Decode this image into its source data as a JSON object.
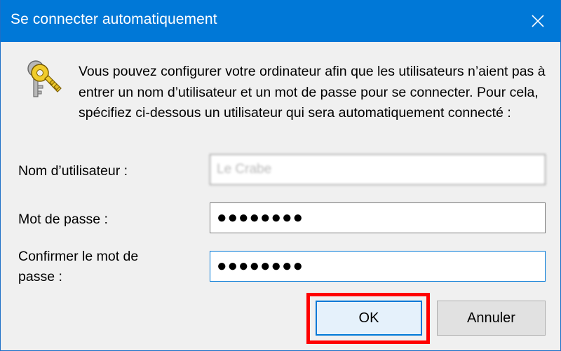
{
  "window": {
    "title": "Se connecter automatiquement"
  },
  "icons": {
    "close": "close-icon",
    "keys": "keys-icon"
  },
  "message": "Vous pouvez configurer votre ordinateur afin que les utilisateurs n’aient pas à entrer un nom d’utilisateur et un mot de passe pour se connecter. Pour cela, spécifiez ci-dessous un utilisateur qui sera automatiquement connecté :",
  "form": {
    "username_label": "Nom d’utilisateur :",
    "username_value": "Le Crabe",
    "password_label": "Mot de passe :",
    "password_value": "●●●●●●●●",
    "confirm_label_line1": "Confirmer le mot de",
    "confirm_label_line2": "passe :",
    "confirm_value": "●●●●●●●●"
  },
  "buttons": {
    "ok_label": "OK",
    "cancel_label": "Annuler"
  },
  "colors": {
    "titlebar": "#0078d7",
    "highlight": "#ff0000",
    "focus": "#0078d7"
  }
}
